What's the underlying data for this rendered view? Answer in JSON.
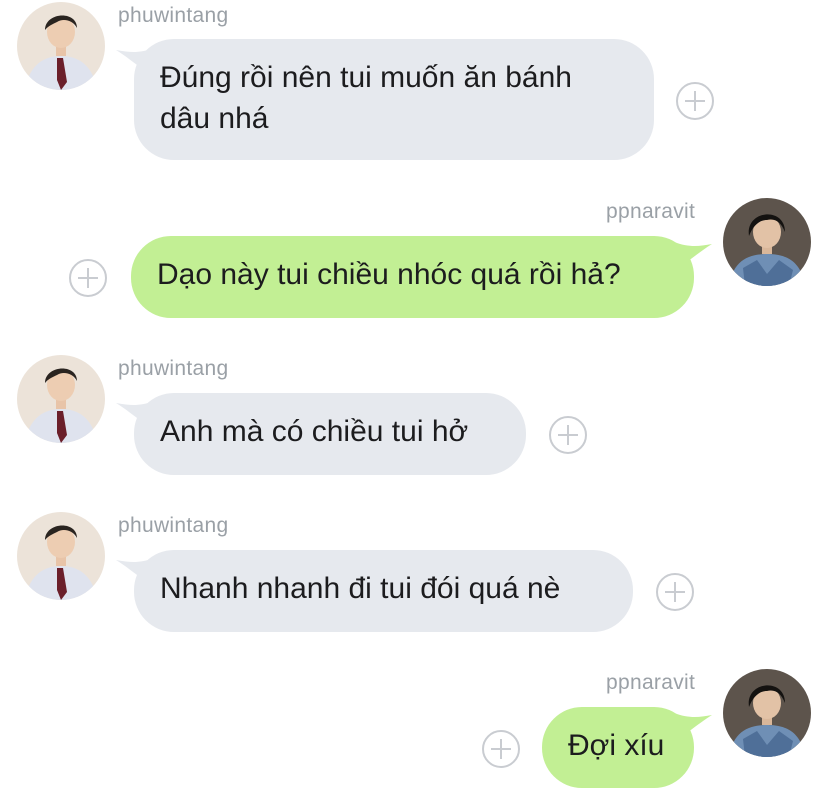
{
  "colors": {
    "incoming_bubble": "#e6e9ee",
    "outgoing_bubble": "#c2ef94",
    "username": "#9aa0a6",
    "add_icon": "#c9ccd1"
  },
  "messages": [
    {
      "sender": "phuwintang",
      "direction": "incoming",
      "text": "Đúng rồi nên tui muốn ăn bánh\ndâu nhá",
      "avatar_icon": "user-avatar-icon",
      "action_icon": "add-reaction-icon"
    },
    {
      "sender": "ppnaravit",
      "direction": "outgoing",
      "text": "Dạo này tui chiều nhóc quá rồi hả?",
      "avatar_icon": "user-avatar-icon",
      "action_icon": "add-reaction-icon"
    },
    {
      "sender": "phuwintang",
      "direction": "incoming",
      "text": "Anh mà có chiều tui hở",
      "avatar_icon": "user-avatar-icon",
      "action_icon": "add-reaction-icon"
    },
    {
      "sender": "phuwintang",
      "direction": "incoming",
      "text": "Nhanh nhanh đi tui đói quá nè",
      "avatar_icon": "user-avatar-icon",
      "action_icon": "add-reaction-icon"
    },
    {
      "sender": "ppnaravit",
      "direction": "outgoing",
      "text": "Đợi xíu",
      "avatar_icon": "user-avatar-icon",
      "action_icon": "add-reaction-icon"
    }
  ]
}
